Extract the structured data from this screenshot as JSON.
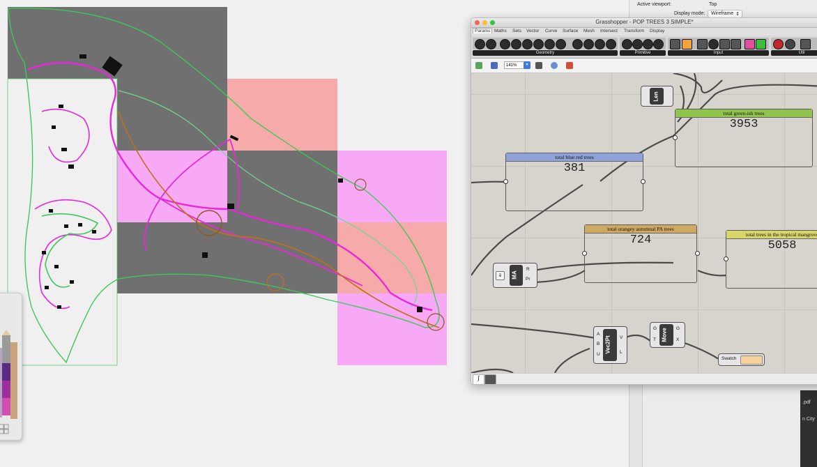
{
  "properties": {
    "viewport_label": "Active viewport:",
    "viewport_value": "Top",
    "display_label": "Display mode:",
    "display_value": "Wireframe",
    "side_texts": [
      ".pdf",
      "n City"
    ]
  },
  "grasshopper": {
    "title": "Grasshopper - POP TREES 3 SIMPLE*",
    "menu_tabs": [
      "Params",
      "Maths",
      "Sets",
      "Vector",
      "Curve",
      "Surface",
      "Mesh",
      "Intersect",
      "Transform",
      "Display"
    ],
    "toolbar_groups": [
      "Geometry",
      "Primitive",
      "Input",
      "Util"
    ],
    "zoom_level": "141%",
    "panels": [
      {
        "title": "total green-ish trees",
        "value": "3953",
        "color": "#b2ef6a"
      },
      {
        "title": "total blue red trees",
        "value": "381",
        "color": "#aebff0"
      },
      {
        "title": "total orangey autumnal PA trees",
        "value": "724",
        "color": "#efcf8e"
      },
      {
        "title": "total trees in the tropical mangrove",
        "value": "5058",
        "color": "#f6f286"
      }
    ],
    "components": {
      "len": "Len",
      "ma": {
        "name": "MA",
        "out_r": "R",
        "out_pr": "Pr"
      },
      "vec2pt": {
        "name": "Vec2Pt",
        "in_a": "A",
        "in_b": "B",
        "in_u": "U",
        "out_v": "V",
        "out_l": "L"
      },
      "move": {
        "name": "Move",
        "in_g": "G",
        "in_t": "T",
        "out_g": "G",
        "out_x": "X"
      },
      "swatch": "Swatch"
    },
    "colors": {
      "swatch": "#f7d39b",
      "canvas": "#d6d4cd"
    }
  },
  "map": {
    "colors": {
      "pink_tile": "#f6aaaa",
      "magenta_tile": "#f7a9f5",
      "grey_tile": "#6f6f6f",
      "road": "#e629d9",
      "coast": "#3fc85a",
      "trail": "#c07118"
    }
  }
}
